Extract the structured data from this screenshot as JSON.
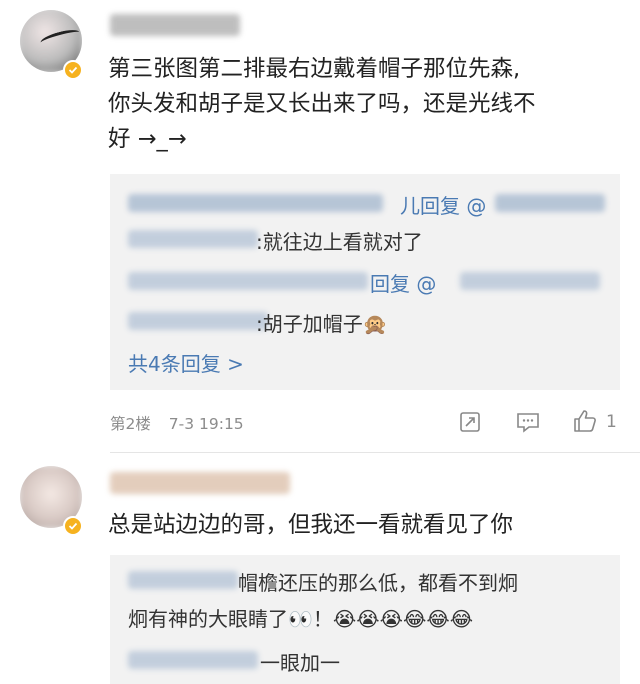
{
  "comments": [
    {
      "text_lines": [
        "第三张图第二排最右边戴着帽子那位先森,",
        "你头发和胡子是又长出来了吗，还是光线不",
        "好 →_→"
      ],
      "replies": [
        {
          "prefix": "儿回复",
          "mention": "@"
        },
        {
          "text": ":就往边上看就对了"
        },
        {
          "prefix": "回复",
          "mention": "@"
        },
        {
          "text": ":胡子加帽子🙊"
        }
      ],
      "more_replies": "共4条回复 >",
      "floor": "第2楼",
      "timestamp": "7-3 19:15",
      "like_count": "1"
    },
    {
      "text": "总是站边边的哥，但我还一看就看见了你",
      "replies": [
        {
          "line1": "帽檐还压的那么低，都看不到炯",
          "line2": "炯有神的大眼睛了👀！😭😭😭😂😂😂"
        },
        {
          "text": "一眼加一"
        }
      ]
    }
  ],
  "icons": {
    "share": "share-icon",
    "comment": "comment-icon",
    "like": "thumbs-up-icon",
    "verified": "verified-badge-icon"
  },
  "colors": {
    "link": "#4a7ab3",
    "reply_bg": "#f2f2f2",
    "meta": "#8c8c8c",
    "badge": "#f6b21f"
  }
}
